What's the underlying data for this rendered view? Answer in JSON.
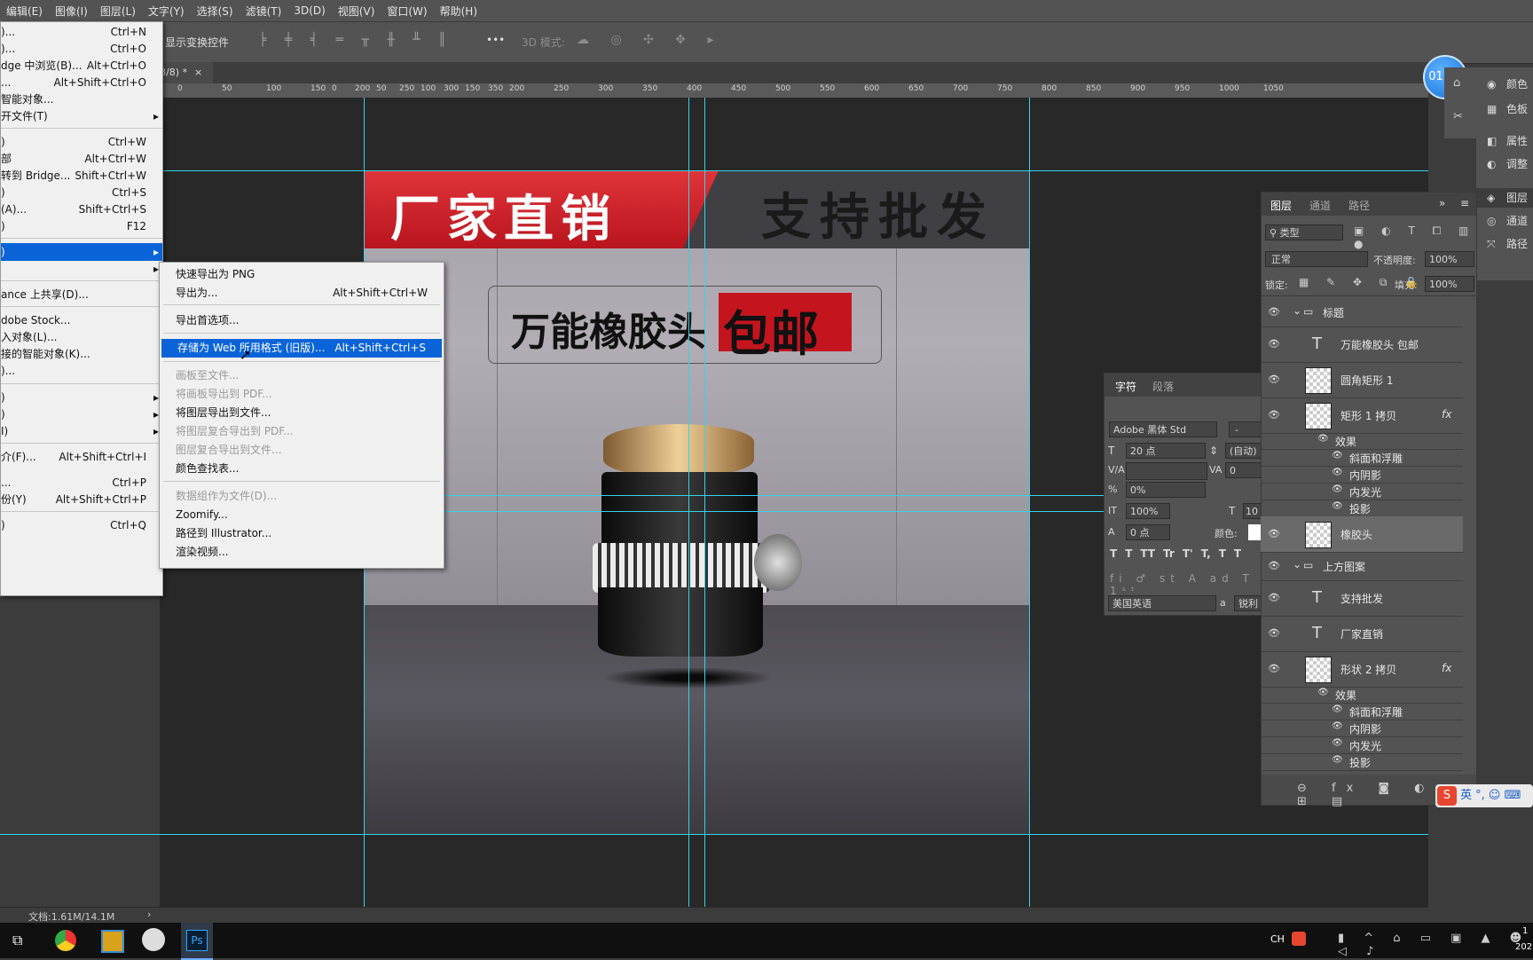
{
  "menubar": [
    "编辑(E)",
    "图像(I)",
    "图层(L)",
    "文字(Y)",
    "选择(S)",
    "滤镜(T)",
    "3D(D)",
    "视图(V)",
    "窗口(W)",
    "帮助(H)"
  ],
  "options": {
    "show_transform": "显示变换控件",
    "mode3d": "3D 模式:",
    "more": "•••"
  },
  "doc_tab": "8/8) *",
  "timer": "01:33",
  "ruler_ticks": [
    "0",
    "50",
    "100",
    "150",
    "200",
    "250",
    "300",
    "350",
    "0",
    "50",
    "100",
    "150",
    "200",
    "250",
    "300",
    "350",
    "400",
    "450",
    "500",
    "550",
    "600",
    "650",
    "700",
    "750",
    "800",
    "850",
    "900",
    "950",
    "1000",
    "1050"
  ],
  "file_menu": [
    {
      "label": ")...",
      "shortcut": "Ctrl+N"
    },
    {
      "label": ")...",
      "shortcut": "Ctrl+O"
    },
    {
      "label": "dge 中浏览(B)...",
      "shortcut": "Alt+Ctrl+O"
    },
    {
      "label": "...",
      "shortcut": "Alt+Shift+Ctrl+O"
    },
    {
      "label": "智能对象...",
      "shortcut": ""
    },
    {
      "label": "开文件(T)",
      "shortcut": "",
      "arrow": true
    },
    {
      "label": ")",
      "shortcut": "Ctrl+W"
    },
    {
      "label": "部",
      "shortcut": "Alt+Ctrl+W"
    },
    {
      "label": "转到 Bridge...",
      "shortcut": "Shift+Ctrl+W"
    },
    {
      "label": ")",
      "shortcut": "Ctrl+S"
    },
    {
      "label": "(A)...",
      "shortcut": "Shift+Ctrl+S"
    },
    {
      "label": ")",
      "shortcut": "F12"
    },
    {
      "label": ")",
      "shortcut": "",
      "arrow": true,
      "selected": true
    },
    {
      "label": "",
      "shortcut": "",
      "arrow": true
    },
    {
      "label": "ance 上共享(D)...",
      "shortcut": ""
    },
    {
      "label": "dobe Stock...",
      "shortcut": ""
    },
    {
      "label": "入对象(L)...",
      "shortcut": ""
    },
    {
      "label": "接的智能对象(K)...",
      "shortcut": ""
    },
    {
      "label": ")...",
      "shortcut": ""
    },
    {
      "label": ")",
      "shortcut": "",
      "arrow": true
    },
    {
      "label": ")",
      "shortcut": "",
      "arrow": true
    },
    {
      "label": "I)",
      "shortcut": "",
      "arrow": true
    },
    {
      "label": "介(F)...",
      "shortcut": "Alt+Shift+Ctrl+I"
    },
    {
      "label": "...",
      "shortcut": "Ctrl+P"
    },
    {
      "label": "份(Y)",
      "shortcut": "Alt+Shift+Ctrl+P"
    },
    {
      "label": ")",
      "shortcut": "Ctrl+Q"
    }
  ],
  "export_menu": [
    {
      "label": "快速导出为 PNG",
      "shortcut": ""
    },
    {
      "label": "导出为...",
      "shortcut": "Alt+Shift+Ctrl+W"
    },
    {
      "label": "导出首选项...",
      "shortcut": ""
    },
    {
      "label": "存储为 Web 所用格式 (旧版)...",
      "shortcut": "Alt+Shift+Ctrl+S",
      "selected": true
    },
    {
      "label": "画板至文件...",
      "shortcut": "",
      "disabled": true
    },
    {
      "label": "将画板导出到 PDF...",
      "shortcut": "",
      "disabled": true
    },
    {
      "label": "将图层导出到文件...",
      "shortcut": ""
    },
    {
      "label": "将图层复合导出到 PDF...",
      "shortcut": "",
      "disabled": true
    },
    {
      "label": "图层复合导出到文件...",
      "shortcut": "",
      "disabled": true
    },
    {
      "label": "颜色查找表...",
      "shortcut": ""
    },
    {
      "label": "数据组作为文件(D)...",
      "shortcut": "",
      "disabled": true
    },
    {
      "label": "Zoomify...",
      "shortcut": ""
    },
    {
      "label": "路径到 Illustrator...",
      "shortcut": ""
    },
    {
      "label": "渲染视频...",
      "shortcut": ""
    }
  ],
  "artwork": {
    "left_banner": "厂家直销",
    "right_banner": "支持批发",
    "headline": "万能橡胶头",
    "headline_badge": "包邮"
  },
  "char_panel": {
    "tabs": [
      "字符",
      "段落"
    ],
    "font": "Adobe 黑体 Std",
    "style": "-",
    "size": "20 点",
    "leading": "(自动)",
    "kerning": "",
    "tracking": "0",
    "scale_pct": "0%",
    "vscale": "100%",
    "hscale": "10",
    "baseline": "0 点",
    "color_label": "颜色:",
    "glyphs": [
      "T",
      "T",
      "TT",
      "Tr",
      "T'",
      "T,",
      "T",
      "T"
    ],
    "language": "美国英语",
    "aa_label": "a",
    "aa": "锐利"
  },
  "layers_panel": {
    "tabs": [
      "图层",
      "通道",
      "路径"
    ],
    "kind": "类型",
    "blend": "正常",
    "opacity_label": "不透明度:",
    "opacity": "100%",
    "lock_label": "锁定:",
    "fill_label": "填充:",
    "fill": "100%",
    "rows": [
      {
        "name": "标题",
        "type": "group"
      },
      {
        "name": "万能橡胶头 包邮",
        "type": "text"
      },
      {
        "name": "圆角矩形 1",
        "type": "smart"
      },
      {
        "name": "矩形 1 拷贝",
        "type": "smart",
        "fx": true
      },
      {
        "name": "效果",
        "type": "effects-head"
      },
      {
        "name": "斜面和浮雕",
        "type": "effect"
      },
      {
        "name": "内阴影",
        "type": "effect"
      },
      {
        "name": "内发光",
        "type": "effect"
      },
      {
        "name": "投影",
        "type": "effect"
      },
      {
        "name": "橡胶头",
        "type": "smart",
        "selected": true
      },
      {
        "name": "上方图案",
        "type": "group"
      },
      {
        "name": "支持批发",
        "type": "text"
      },
      {
        "name": "厂家直销",
        "type": "text"
      },
      {
        "name": "形状 2 拷贝",
        "type": "smart",
        "fx": true
      },
      {
        "name": "效果",
        "type": "effects-head"
      },
      {
        "name": "斜面和浮雕",
        "type": "effect"
      },
      {
        "name": "内阴影",
        "type": "effect"
      },
      {
        "name": "内发光",
        "type": "effect"
      },
      {
        "name": "投影",
        "type": "effect"
      }
    ]
  },
  "right_dock": [
    "颜色",
    "色板",
    "属性",
    "调整",
    "图层",
    "通道",
    "路径"
  ],
  "status": "文档:1.61M/14.1M",
  "ime": "英",
  "taskbar": {
    "lang": "CH",
    "clock1": "1",
    "clock2": "202"
  }
}
